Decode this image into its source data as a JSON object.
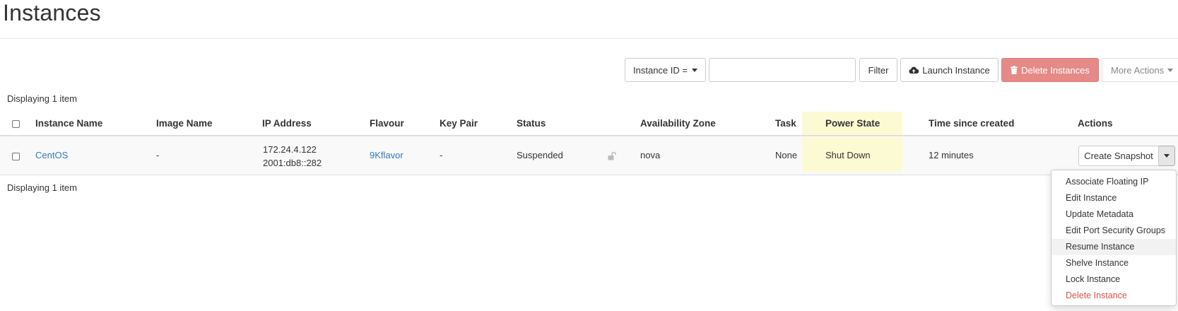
{
  "page": {
    "title": "Instances"
  },
  "toolbar": {
    "filter_select_label": "Instance ID =",
    "filter_input_value": "",
    "filter_button": "Filter",
    "launch_button": "Launch Instance",
    "delete_button": "Delete Instances",
    "more_actions": "More Actions"
  },
  "table": {
    "count_label": "Displaying 1 item",
    "headers": {
      "instance_name": "Instance Name",
      "image_name": "Image Name",
      "ip_address": "IP Address",
      "flavour": "Flavour",
      "key_pair": "Key Pair",
      "status": "Status",
      "availability_zone": "Availability Zone",
      "task": "Task",
      "power_state": "Power State",
      "time_since_created": "Time since created",
      "actions": "Actions"
    },
    "rows": [
      {
        "instance_name": "CentOS",
        "image_name": "-",
        "ip_address": [
          "172.24.4.122",
          "2001:db8::282"
        ],
        "flavour": "9Kflavor",
        "key_pair": "-",
        "status": "Suspended",
        "status_icon": "unlocked-padlock-icon",
        "availability_zone": "nova",
        "task": "None",
        "power_state": "Shut Down",
        "time_since_created": "12 minutes",
        "action_button": "Create Snapshot"
      }
    ]
  },
  "actions_menu": {
    "items": [
      "Associate Floating IP",
      "Edit Instance",
      "Update Metadata",
      "Edit Port Security Groups",
      "Resume Instance",
      "Shelve Instance",
      "Lock Instance",
      "Delete Instance"
    ],
    "hovered_item": "Resume Instance",
    "danger_color": "#d9534f"
  },
  "colors": {
    "link": "#337ab7",
    "power_state_highlight": "#fcfad3",
    "delete_button_bg": "#e58a87"
  }
}
